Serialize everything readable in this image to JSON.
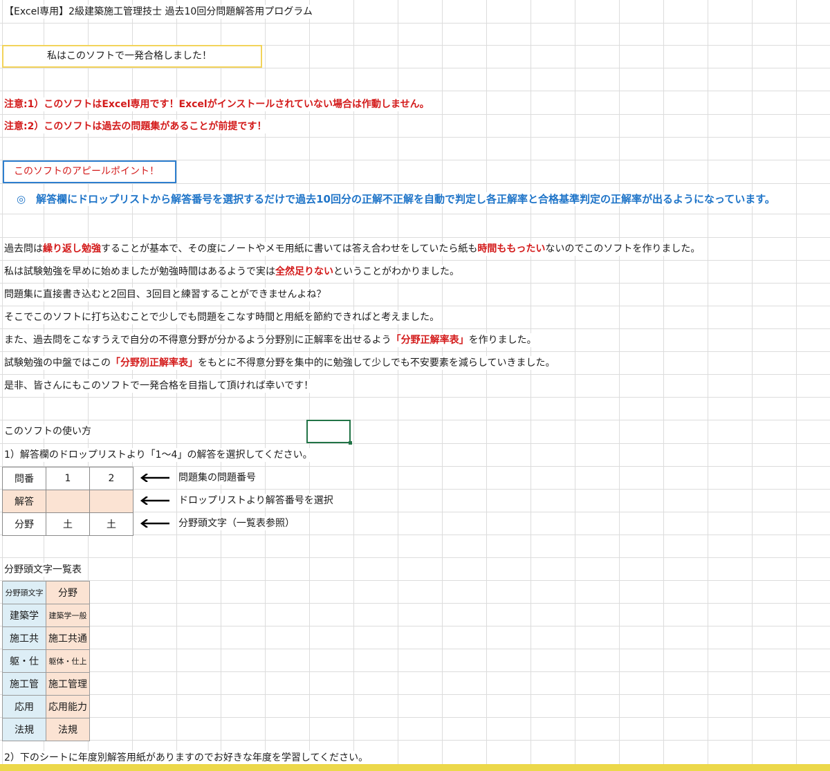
{
  "title": "【Excel専用】2級建築施工管理技士 過去10回分問題解答用プログラム",
  "banner": "私はこのソフトで一発合格しました！",
  "notes": [
    "注意:1）このソフトはExcel専用です！Excelがインストールされていない場合は作動しません。",
    "注意:2）このソフトは過去の問題集があることが前提です！"
  ],
  "appeal_box": "このソフトのアピールポイント！",
  "appeal_text": "◎　解答欄にドロップリストから解答番号を選択するだけで過去10回分の正解不正解を自動で判定し各正解率と合格基準判定の正解率が出るようになっています。",
  "body": {
    "p1": {
      "a": "過去問は",
      "b": "繰り返し勉強",
      "c": "することが基本で、その度にノートやメモ用紙に書いては答え合わせをしていたら紙も",
      "d": "時間ももったい",
      "e": "ないのでこのソフトを作りました。"
    },
    "p2": {
      "a": "私は試験勉強を早めに始めましたが勉強時間はあるようで実は",
      "b": "全然足りない",
      "c": "ということがわかりました。"
    },
    "p3": "問題集に直接書き込むと2回目、3回目と練習することができませんよね？",
    "p4": "そこでこのソフトに打ち込むことで少しでも問題をこなす時間と用紙を節約できればと考えました。",
    "p5": {
      "a": "また、過去問をこなすうえで自分の不得意分野が分かるよう分野別に正解率を出せるよう",
      "b": "「分野正解率表」",
      "c": "を作りました。"
    },
    "p6": {
      "a": "試験勉強の中盤ではこの",
      "b": "「分野別正解率表」",
      "c": "をもとに不得意分野を集中的に勉強して少しでも不安要素を減らしていきました。"
    },
    "p7": "是非、皆さんにもこのソフトで一発合格を目指して頂ければ幸いです！"
  },
  "usage": {
    "heading": "このソフトの使い方",
    "step1": "1）解答欄のドロップリストより「1～4」の解答を選択してください。",
    "table": {
      "row1": [
        "問番",
        "1",
        "2"
      ],
      "row2": [
        "解答",
        "",
        ""
      ],
      "row3": [
        "分野",
        "土",
        "土"
      ]
    },
    "annotations": [
      "問題集の問題番号",
      "ドロップリストより解答番号を選択",
      "分野頭文字（一覧表参照）"
    ],
    "step2": "2）下のシートに年度別解答用紙がありますのでお好きな年度を学習してください。"
  },
  "legend": {
    "heading": "分野頭文字一覧表",
    "header": [
      "分野頭文字",
      "分野"
    ],
    "rows": [
      [
        "建築学",
        "建築学一般"
      ],
      [
        "施工共",
        "施工共通"
      ],
      [
        "躯・仕",
        "躯体・仕上"
      ],
      [
        "施工管",
        "施工管理"
      ],
      [
        "応用",
        "応用能力"
      ],
      [
        "法規",
        "法規"
      ]
    ]
  },
  "colors": {
    "red": "#d31a1a",
    "blue": "#1e74c8",
    "answer_fill": "#fbe3d3",
    "legend_key_fill": "#ddeef6",
    "banner_border": "#f2d35a"
  }
}
